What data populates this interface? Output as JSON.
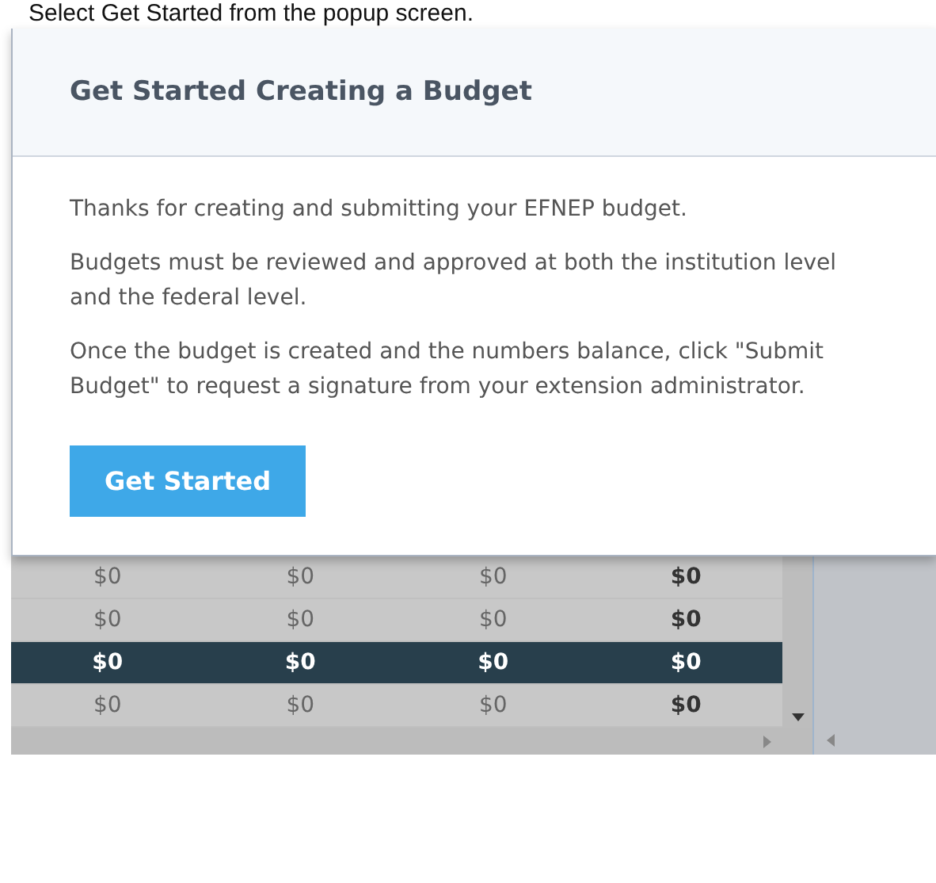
{
  "caption": "Select Get Started from the popup screen.",
  "modal": {
    "title": "Get Started Creating a Budget",
    "paragraphs": [
      "Thanks for creating and submitting your EFNEP budget.",
      "Budgets must be reviewed and approved at both the institution level and the federal level.",
      "Once the budget is created and the numbers balance, click \"Submit Budget\" to request a signature from your extension administrator."
    ],
    "button": "Get Started"
  },
  "table": {
    "rows": [
      {
        "highlighted": false,
        "cells": [
          "$0",
          "$0",
          "$0",
          "$0"
        ]
      },
      {
        "highlighted": false,
        "cells": [
          "$0",
          "$0",
          "$0",
          "$0"
        ]
      },
      {
        "highlighted": true,
        "cells": [
          "$0",
          "$0",
          "$0",
          "$0"
        ]
      },
      {
        "highlighted": false,
        "cells": [
          "$0",
          "$0",
          "$0",
          "$0"
        ]
      }
    ]
  }
}
